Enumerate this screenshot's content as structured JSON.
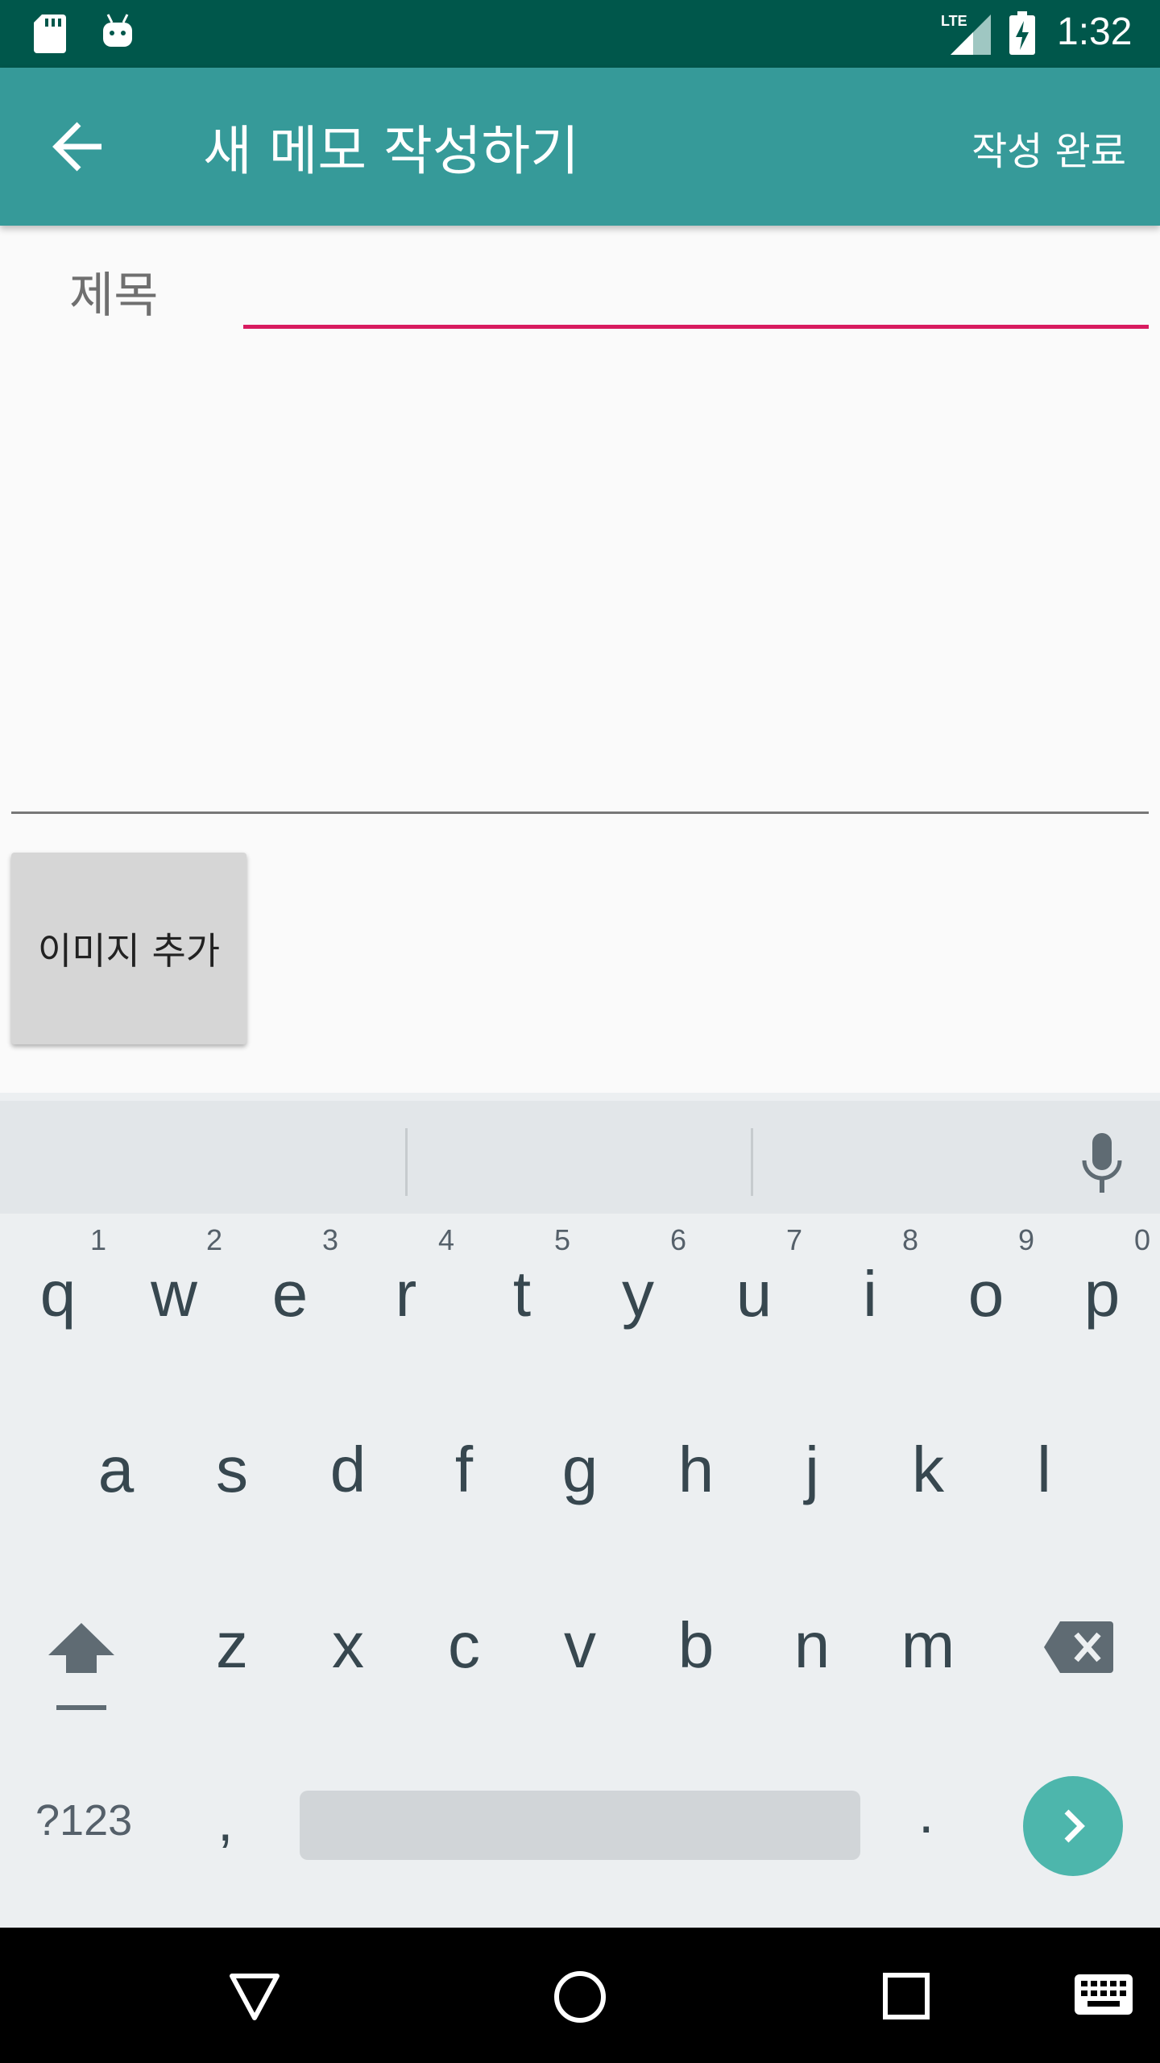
{
  "status_bar": {
    "time": "1:32",
    "network": "LTE",
    "icons": [
      "sd-card-icon",
      "android-icon",
      "lte-signal-icon",
      "battery-charging-icon"
    ]
  },
  "app_bar": {
    "title": "새 메모 작성하기",
    "back_icon": "arrow-left-icon",
    "done_label": "작성 완료",
    "background": "#369a99"
  },
  "form": {
    "title_label": "제목",
    "title_value": "",
    "content_value": "",
    "add_image_label": "이미지 추가",
    "accent": "#d81b60"
  },
  "keyboard": {
    "row1": [
      {
        "key": "q",
        "hint": "1"
      },
      {
        "key": "w",
        "hint": "2"
      },
      {
        "key": "e",
        "hint": "3"
      },
      {
        "key": "r",
        "hint": "4"
      },
      {
        "key": "t",
        "hint": "5"
      },
      {
        "key": "y",
        "hint": "6"
      },
      {
        "key": "u",
        "hint": "7"
      },
      {
        "key": "i",
        "hint": "8"
      },
      {
        "key": "o",
        "hint": "9"
      },
      {
        "key": "p",
        "hint": "0"
      }
    ],
    "row2": [
      "a",
      "s",
      "d",
      "f",
      "g",
      "h",
      "j",
      "k",
      "l"
    ],
    "row3": [
      "z",
      "x",
      "c",
      "v",
      "b",
      "n",
      "m"
    ],
    "symbols_label": "?123",
    "comma": ",",
    "period": ".",
    "enter_color": "#4db6ac"
  },
  "nav_bar": {
    "icons": [
      "back-triangle-icon",
      "home-circle-icon",
      "recents-square-icon",
      "keyboard-switch-icon"
    ]
  }
}
